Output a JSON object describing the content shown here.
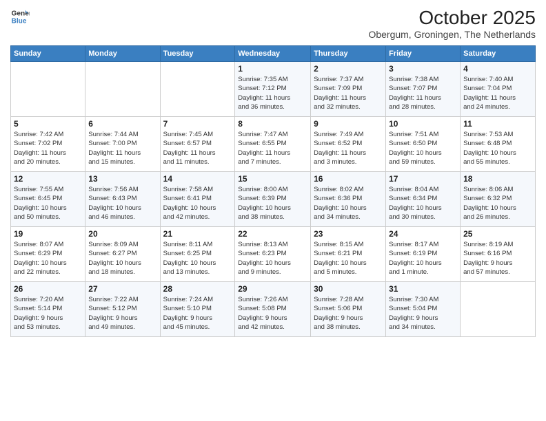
{
  "logo": {
    "line1": "General",
    "line2": "Blue"
  },
  "title": "October 2025",
  "subtitle": "Obergum, Groningen, The Netherlands",
  "days_of_week": [
    "Sunday",
    "Monday",
    "Tuesday",
    "Wednesday",
    "Thursday",
    "Friday",
    "Saturday"
  ],
  "weeks": [
    [
      {
        "day": "",
        "info": ""
      },
      {
        "day": "",
        "info": ""
      },
      {
        "day": "",
        "info": ""
      },
      {
        "day": "1",
        "info": "Sunrise: 7:35 AM\nSunset: 7:12 PM\nDaylight: 11 hours\nand 36 minutes."
      },
      {
        "day": "2",
        "info": "Sunrise: 7:37 AM\nSunset: 7:09 PM\nDaylight: 11 hours\nand 32 minutes."
      },
      {
        "day": "3",
        "info": "Sunrise: 7:38 AM\nSunset: 7:07 PM\nDaylight: 11 hours\nand 28 minutes."
      },
      {
        "day": "4",
        "info": "Sunrise: 7:40 AM\nSunset: 7:04 PM\nDaylight: 11 hours\nand 24 minutes."
      }
    ],
    [
      {
        "day": "5",
        "info": "Sunrise: 7:42 AM\nSunset: 7:02 PM\nDaylight: 11 hours\nand 20 minutes."
      },
      {
        "day": "6",
        "info": "Sunrise: 7:44 AM\nSunset: 7:00 PM\nDaylight: 11 hours\nand 15 minutes."
      },
      {
        "day": "7",
        "info": "Sunrise: 7:45 AM\nSunset: 6:57 PM\nDaylight: 11 hours\nand 11 minutes."
      },
      {
        "day": "8",
        "info": "Sunrise: 7:47 AM\nSunset: 6:55 PM\nDaylight: 11 hours\nand 7 minutes."
      },
      {
        "day": "9",
        "info": "Sunrise: 7:49 AM\nSunset: 6:52 PM\nDaylight: 11 hours\nand 3 minutes."
      },
      {
        "day": "10",
        "info": "Sunrise: 7:51 AM\nSunset: 6:50 PM\nDaylight: 10 hours\nand 59 minutes."
      },
      {
        "day": "11",
        "info": "Sunrise: 7:53 AM\nSunset: 6:48 PM\nDaylight: 10 hours\nand 55 minutes."
      }
    ],
    [
      {
        "day": "12",
        "info": "Sunrise: 7:55 AM\nSunset: 6:45 PM\nDaylight: 10 hours\nand 50 minutes."
      },
      {
        "day": "13",
        "info": "Sunrise: 7:56 AM\nSunset: 6:43 PM\nDaylight: 10 hours\nand 46 minutes."
      },
      {
        "day": "14",
        "info": "Sunrise: 7:58 AM\nSunset: 6:41 PM\nDaylight: 10 hours\nand 42 minutes."
      },
      {
        "day": "15",
        "info": "Sunrise: 8:00 AM\nSunset: 6:39 PM\nDaylight: 10 hours\nand 38 minutes."
      },
      {
        "day": "16",
        "info": "Sunrise: 8:02 AM\nSunset: 6:36 PM\nDaylight: 10 hours\nand 34 minutes."
      },
      {
        "day": "17",
        "info": "Sunrise: 8:04 AM\nSunset: 6:34 PM\nDaylight: 10 hours\nand 30 minutes."
      },
      {
        "day": "18",
        "info": "Sunrise: 8:06 AM\nSunset: 6:32 PM\nDaylight: 10 hours\nand 26 minutes."
      }
    ],
    [
      {
        "day": "19",
        "info": "Sunrise: 8:07 AM\nSunset: 6:29 PM\nDaylight: 10 hours\nand 22 minutes."
      },
      {
        "day": "20",
        "info": "Sunrise: 8:09 AM\nSunset: 6:27 PM\nDaylight: 10 hours\nand 18 minutes."
      },
      {
        "day": "21",
        "info": "Sunrise: 8:11 AM\nSunset: 6:25 PM\nDaylight: 10 hours\nand 13 minutes."
      },
      {
        "day": "22",
        "info": "Sunrise: 8:13 AM\nSunset: 6:23 PM\nDaylight: 10 hours\nand 9 minutes."
      },
      {
        "day": "23",
        "info": "Sunrise: 8:15 AM\nSunset: 6:21 PM\nDaylight: 10 hours\nand 5 minutes."
      },
      {
        "day": "24",
        "info": "Sunrise: 8:17 AM\nSunset: 6:19 PM\nDaylight: 10 hours\nand 1 minute."
      },
      {
        "day": "25",
        "info": "Sunrise: 8:19 AM\nSunset: 6:16 PM\nDaylight: 9 hours\nand 57 minutes."
      }
    ],
    [
      {
        "day": "26",
        "info": "Sunrise: 7:20 AM\nSunset: 5:14 PM\nDaylight: 9 hours\nand 53 minutes."
      },
      {
        "day": "27",
        "info": "Sunrise: 7:22 AM\nSunset: 5:12 PM\nDaylight: 9 hours\nand 49 minutes."
      },
      {
        "day": "28",
        "info": "Sunrise: 7:24 AM\nSunset: 5:10 PM\nDaylight: 9 hours\nand 45 minutes."
      },
      {
        "day": "29",
        "info": "Sunrise: 7:26 AM\nSunset: 5:08 PM\nDaylight: 9 hours\nand 42 minutes."
      },
      {
        "day": "30",
        "info": "Sunrise: 7:28 AM\nSunset: 5:06 PM\nDaylight: 9 hours\nand 38 minutes."
      },
      {
        "day": "31",
        "info": "Sunrise: 7:30 AM\nSunset: 5:04 PM\nDaylight: 9 hours\nand 34 minutes."
      },
      {
        "day": "",
        "info": ""
      }
    ]
  ]
}
